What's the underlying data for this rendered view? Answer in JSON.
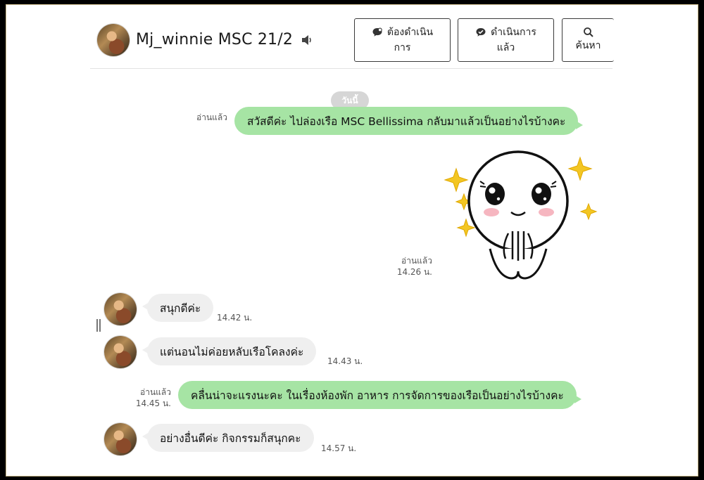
{
  "header": {
    "title": "Mj_winnie MSC 21/2",
    "speaker_icon": "speaker-icon",
    "buttons": {
      "todo": {
        "line1": "ต้องดำเนิน",
        "line2": "การ",
        "icon": "chat-bubble-icon"
      },
      "done": {
        "line1": "ดำเนินการ",
        "line2": "แล้ว",
        "icon": "check-bubble-icon"
      },
      "search": {
        "label": "ค้นหา",
        "icon": "search-icon"
      }
    }
  },
  "date_chip": "วันนี้",
  "messages": [
    {
      "side": "out",
      "text": "สวัสดีค่ะ ไปล่องเรือ MSC Bellissima กลับมาแล้วเป็นอย่างไรบ้างคะ",
      "read": "อ่านแล้ว",
      "time": ""
    },
    {
      "side": "out",
      "type": "sticker",
      "sticker_name": "pleading-face-sticker",
      "read": "อ่านแล้ว",
      "time": "14.26 น."
    },
    {
      "side": "in",
      "text": "สนุกดีค่ะ",
      "time": "14.42 น."
    },
    {
      "side": "in",
      "text": "แต่นอนไม่ค่อยหลับเรือโคลงค่ะ",
      "time": "14.43 น."
    },
    {
      "side": "out",
      "text": "คลื่นน่าจะแรงนะคะ  ในเรื่องห้องพัก อาหาร การจัดการของเรือเป็นอย่างไรบ้างคะ",
      "read": "อ่านแล้ว",
      "time": "14.45 น."
    },
    {
      "side": "in",
      "text": "อย่างอื่นดีค่ะ กิจกรรมก็สนุกคะ",
      "time": "14.57 น."
    }
  ],
  "colors": {
    "outgoing_bubble": "#a6e4a4",
    "incoming_bubble": "#efefef",
    "frame": "#000000"
  }
}
